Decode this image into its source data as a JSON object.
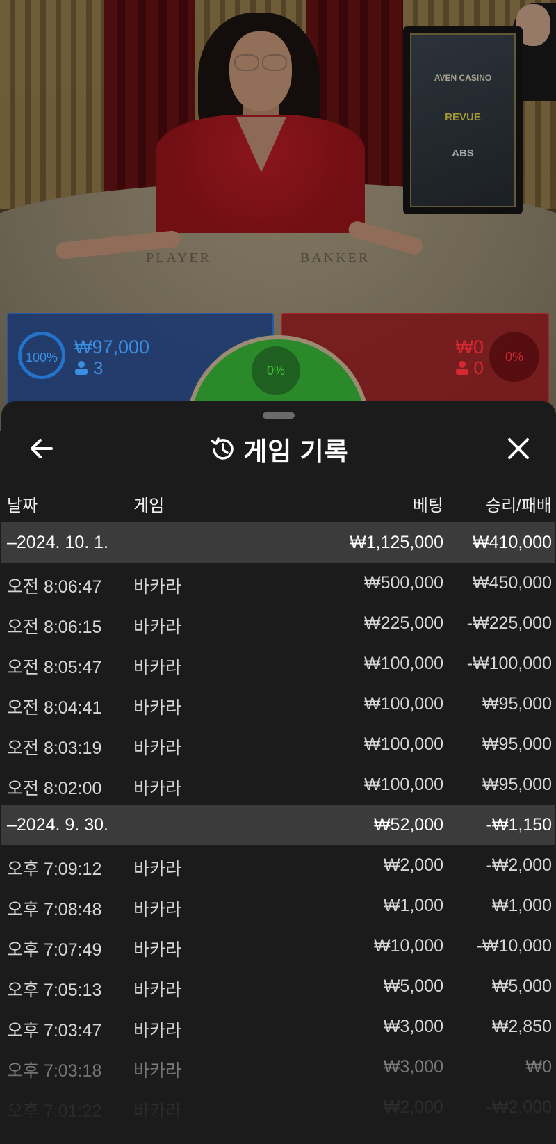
{
  "video": {
    "table_player_label": "PLAYER",
    "table_banker_label": "BANKER",
    "sponsors": [
      "AVEN CASINO",
      "REVUE",
      "ABS"
    ]
  },
  "bets": {
    "player": {
      "percent": "100%",
      "amount": "₩97,000",
      "count": "3",
      "color": "#2273c9"
    },
    "tie": {
      "percent": "0%",
      "color": "#2a8a2a"
    },
    "banker": {
      "percent": "0%",
      "amount": "₩0",
      "count": "0",
      "color": "#d62830"
    }
  },
  "sheet": {
    "title": "게임 기록",
    "icons": {
      "back": "arrow-left-icon",
      "title": "history-clock-icon",
      "close": "close-x-icon"
    }
  },
  "columns": {
    "date": "날짜",
    "game": "게임",
    "bet": "베팅",
    "result": "승리/패배"
  },
  "groups": [
    {
      "date": "–2024. 10. 1.",
      "bet_total": "₩1,125,000",
      "result_total": "₩410,000",
      "rows": [
        {
          "time": "오전 8:06:47",
          "game": "바카라",
          "bet": "₩500,000",
          "result": "₩450,000"
        },
        {
          "time": "오전 8:06:15",
          "game": "바카라",
          "bet": "₩225,000",
          "result": "-₩225,000"
        },
        {
          "time": "오전 8:05:47",
          "game": "바카라",
          "bet": "₩100,000",
          "result": "-₩100,000"
        },
        {
          "time": "오전 8:04:41",
          "game": "바카라",
          "bet": "₩100,000",
          "result": "₩95,000"
        },
        {
          "time": "오전 8:03:19",
          "game": "바카라",
          "bet": "₩100,000",
          "result": "₩95,000"
        },
        {
          "time": "오전 8:02:00",
          "game": "바카라",
          "bet": "₩100,000",
          "result": "₩95,000"
        }
      ]
    },
    {
      "date": "–2024. 9. 30.",
      "bet_total": "₩52,000",
      "result_total": "-₩1,150",
      "rows": [
        {
          "time": "오후 7:09:12",
          "game": "바카라",
          "bet": "₩2,000",
          "result": "-₩2,000"
        },
        {
          "time": "오후 7:08:48",
          "game": "바카라",
          "bet": "₩1,000",
          "result": "₩1,000"
        },
        {
          "time": "오후 7:07:49",
          "game": "바카라",
          "bet": "₩10,000",
          "result": "-₩10,000"
        },
        {
          "time": "오후 7:05:13",
          "game": "바카라",
          "bet": "₩5,000",
          "result": "₩5,000"
        },
        {
          "time": "오후 7:03:47",
          "game": "바카라",
          "bet": "₩3,000",
          "result": "₩2,850"
        },
        {
          "time": "오후 7:03:18",
          "game": "바카라",
          "bet": "₩3,000",
          "result": "₩0"
        },
        {
          "time": "오후 7:01:22",
          "game": "바카라",
          "bet": "₩2,000",
          "result": "-₩2,000"
        }
      ]
    }
  ]
}
